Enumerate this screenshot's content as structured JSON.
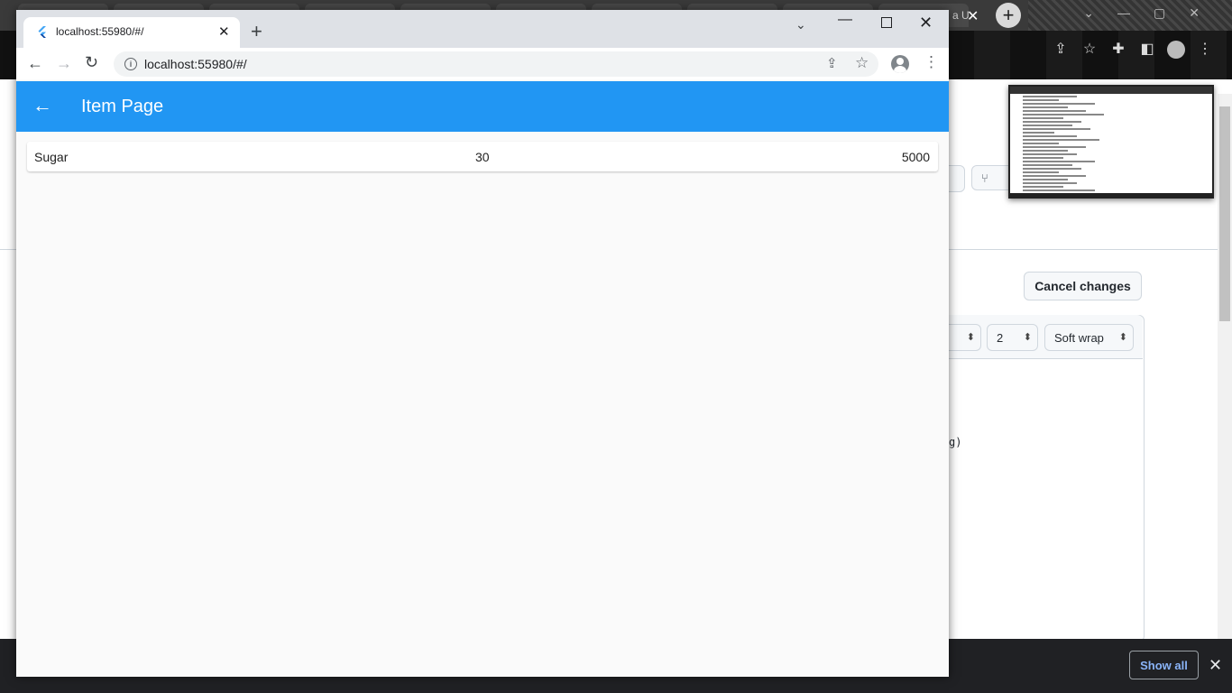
{
  "background": {
    "cancel_label": "Cancel changes",
    "indent_value": "2",
    "wrap_value": "Soft wrap",
    "code_fragment": "g)",
    "bg_tab_text": "a U",
    "show_all_label": "Show all"
  },
  "browser": {
    "tab_title": "localhost:55980/#/",
    "url": "localhost:55980/#/"
  },
  "app": {
    "title": "Item Page",
    "items": [
      {
        "name": "Sugar",
        "quantity": "30",
        "price": "5000"
      }
    ]
  },
  "colors": {
    "appbar": "#2196f3",
    "tab_strip": "#dee1e6",
    "content_bg": "#fafafa"
  }
}
